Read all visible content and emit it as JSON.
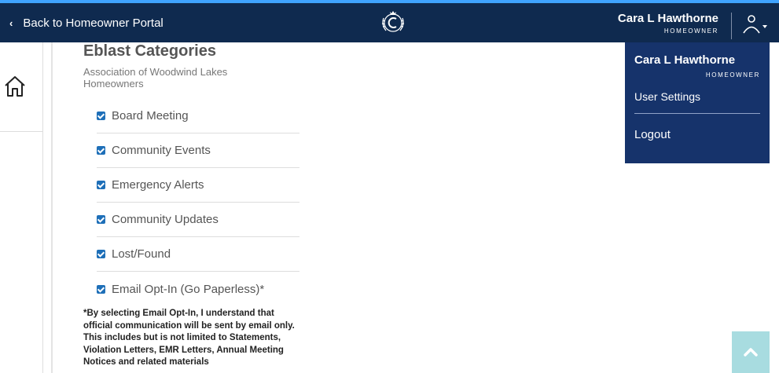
{
  "header": {
    "back_label": "Back to Homeowner Portal",
    "user_name": "Cara L Hawthorne",
    "user_role": "HOMEOWNER",
    "icons": {
      "back": "chevron-left-icon",
      "logo": "community-crest-logo",
      "user": "user-icon"
    }
  },
  "sidebar": {
    "icons": {
      "home": "home-icon"
    }
  },
  "main": {
    "title": "Eblast Categories",
    "subtitle": "Association of Woodwind Lakes Homeowners",
    "categories": [
      {
        "label": "Board Meeting",
        "checked": true
      },
      {
        "label": "Community Events",
        "checked": true
      },
      {
        "label": "Emergency Alerts",
        "checked": true
      },
      {
        "label": "Community Updates",
        "checked": true
      },
      {
        "label": "Lost/Found",
        "checked": true
      },
      {
        "label": "Email Opt-In (Go Paperless)*",
        "checked": true
      }
    ],
    "note": "*By selecting Email Opt-In, I understand that official communication will be sent by email only. This includes but is not limited to Statements, Violation Letters, EMR Letters, Annual Meeting Notices and related materials"
  },
  "dropdown": {
    "user_name": "Cara L Hawthorne",
    "user_role": "HOMEOWNER",
    "settings_label": "User Settings",
    "logout_label": "Logout"
  },
  "colors": {
    "header_bg": "#0f2a4f",
    "dropdown_bg": "#16336b",
    "checkbox": "#1e6fb8",
    "scroll_top_bg": "#a8dce0",
    "accent_top": "#3fa3ff"
  }
}
